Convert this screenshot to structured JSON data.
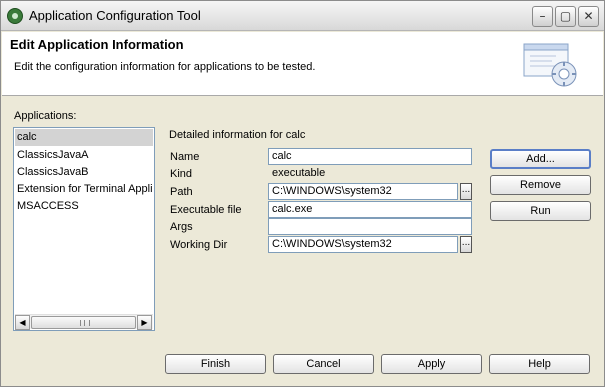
{
  "window": {
    "title": "Application Configuration Tool",
    "controls": {
      "minimize": "–",
      "maximize": "▢",
      "close": "✕"
    }
  },
  "header": {
    "title": "Edit Application Information",
    "description": "Edit the configuration information for applications to be tested."
  },
  "applications": {
    "label": "Applications:",
    "items": [
      "calc",
      "ClassicsJavaA",
      "ClassicsJavaB",
      "Extension for Terminal Applic",
      "MSACCESS"
    ],
    "selected": "calc"
  },
  "details": {
    "heading": "Detailed information for calc",
    "fields": {
      "name": {
        "label": "Name",
        "value": "calc"
      },
      "kind": {
        "label": "Kind",
        "value": "executable"
      },
      "path": {
        "label": "Path",
        "value": "C:\\WINDOWS\\system32"
      },
      "executable": {
        "label": "Executable file",
        "value": "calc.exe"
      },
      "args": {
        "label": "Args",
        "value": ""
      },
      "working_dir": {
        "label": "Working Dir",
        "value": "C:\\WINDOWS\\system32"
      }
    },
    "browse_label": "..."
  },
  "side_buttons": {
    "add": "Add...",
    "remove": "Remove",
    "run": "Run"
  },
  "bottom_buttons": {
    "finish": "Finish",
    "cancel": "Cancel",
    "apply": "Apply",
    "help": "Help"
  },
  "scrollbar": {
    "left": "◀",
    "right": "▶"
  },
  "icons": {
    "app": "app-logo-icon",
    "header": "config-wizard-icon"
  }
}
